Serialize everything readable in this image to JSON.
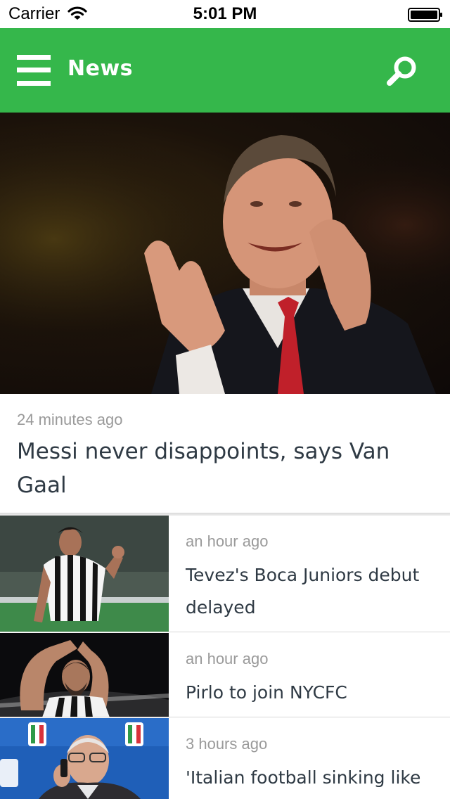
{
  "status_bar": {
    "carrier": "Carrier",
    "time": "5:01 PM",
    "wifi_icon": "wifi-icon",
    "battery_icon": "battery-icon"
  },
  "nav": {
    "title": "News",
    "menu_icon": "hamburger-menu-icon",
    "search_icon": "search-icon"
  },
  "theme": {
    "accent": "#35b74b",
    "text": "#2f3a44",
    "muted": "#9a9a9a"
  },
  "hero": {
    "time": "24 minutes ago",
    "headline": "Messi never disappoints, says Van Gaal"
  },
  "articles": [
    {
      "time": "an hour ago",
      "title": "Tevez's Boca Juniors debut delayed"
    },
    {
      "time": "an hour ago",
      "title": "Pirlo to join NYCFC"
    },
    {
      "time": "3 hours ago",
      "title": "'Italian football sinking like"
    }
  ]
}
